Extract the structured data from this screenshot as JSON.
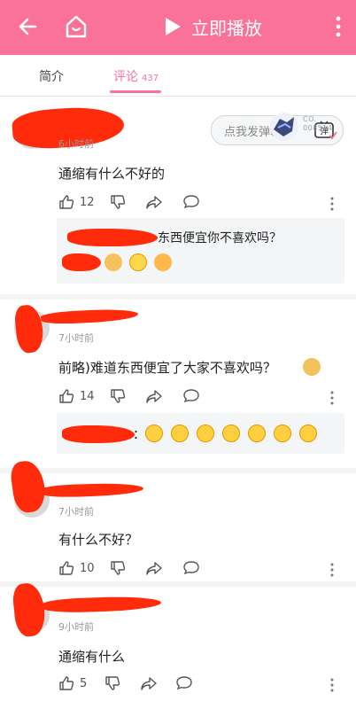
{
  "topbar": {
    "play_label": "立即播放",
    "icons": [
      "back-arrow-icon",
      "home-icon",
      "play-icon",
      "more-vertical-icon"
    ]
  },
  "tabs": {
    "intro": "简介",
    "comments": "评论",
    "comments_count": "437"
  },
  "danmaku": {
    "placeholder": "点我发弹幕",
    "icon_label": "弹"
  },
  "colors": {
    "accent": "#fb7299",
    "redaction": "#ff2b0a"
  },
  "badge": {
    "line1": "CO.",
    "line2": "008514"
  },
  "comments": [
    {
      "time": "6小时前",
      "text": "通缩有什么不好的",
      "likes": "12",
      "reply": {
        "text": "东西便宜你不喜欢吗？",
        "emojis": [
          "dog",
          "smile",
          "tongue"
        ]
      }
    },
    {
      "time": "7小时前",
      "text": "前略)难道东西便宜了大家不喜欢吗？",
      "likes": "14",
      "reply": {
        "prefix": "：",
        "emojis": [
          "cry",
          "cry",
          "cry",
          "cry",
          "cry",
          "cry",
          "cry"
        ]
      }
    },
    {
      "time": "7小时前",
      "text": "有什么不好？",
      "likes": "10"
    },
    {
      "time": "9小时前",
      "text": "通缩有什么",
      "likes": "5"
    }
  ]
}
